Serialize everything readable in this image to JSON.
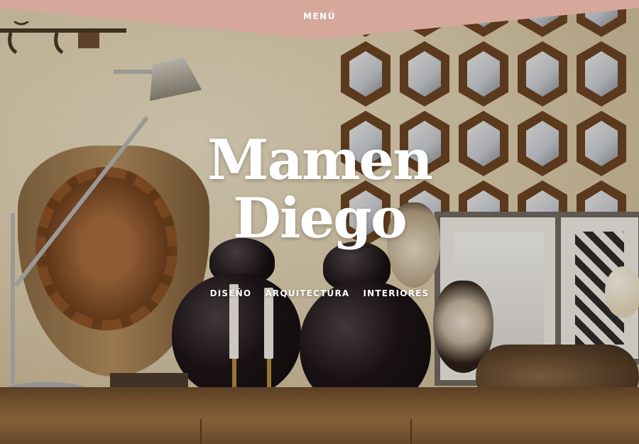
{
  "menu": {
    "label": "MENÚ"
  },
  "hero": {
    "title_line1": "Mamen",
    "title_line2": "Diego"
  },
  "nav": {
    "items": [
      "DISEÑO",
      "ARQUITECTURA",
      "INTERIORES"
    ]
  },
  "colors": {
    "menu_tab": "#d6a89c",
    "text": "#ffffff"
  }
}
